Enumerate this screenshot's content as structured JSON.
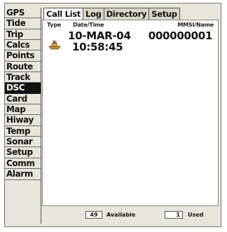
{
  "sidebar": {
    "items": [
      {
        "label": "GPS"
      },
      {
        "label": "Tide"
      },
      {
        "label": "Trip"
      },
      {
        "label": "Calcs"
      },
      {
        "label": "Points"
      },
      {
        "label": "Route"
      },
      {
        "label": "Track"
      },
      {
        "label": "DSC"
      },
      {
        "label": "Card"
      },
      {
        "label": "Map"
      },
      {
        "label": "Hiway"
      },
      {
        "label": "Temp"
      },
      {
        "label": "Sonar"
      },
      {
        "label": "Setup"
      },
      {
        "label": "Comm"
      },
      {
        "label": "Alarm"
      }
    ],
    "active": "DSC"
  },
  "tabs": [
    {
      "label": "Call List"
    },
    {
      "label": "Log"
    },
    {
      "label": "Directory"
    },
    {
      "label": "Setup"
    }
  ],
  "table": {
    "headers": {
      "type": "Type",
      "datetime": "Date/Time",
      "mmsi": "MMSI/Name"
    },
    "rows": [
      {
        "icon": "boat-icon",
        "date": "10-MAR-04",
        "time": "10:58:45",
        "mmsi": "000000001"
      }
    ]
  },
  "footer": {
    "available_count": "49",
    "available_label": "Available",
    "used_count": "1",
    "used_label": "Used"
  },
  "colors": {
    "background": "#e8e6da",
    "active_item": "#111111",
    "content": "#ffffff",
    "boat_icon": "#d9a441"
  }
}
